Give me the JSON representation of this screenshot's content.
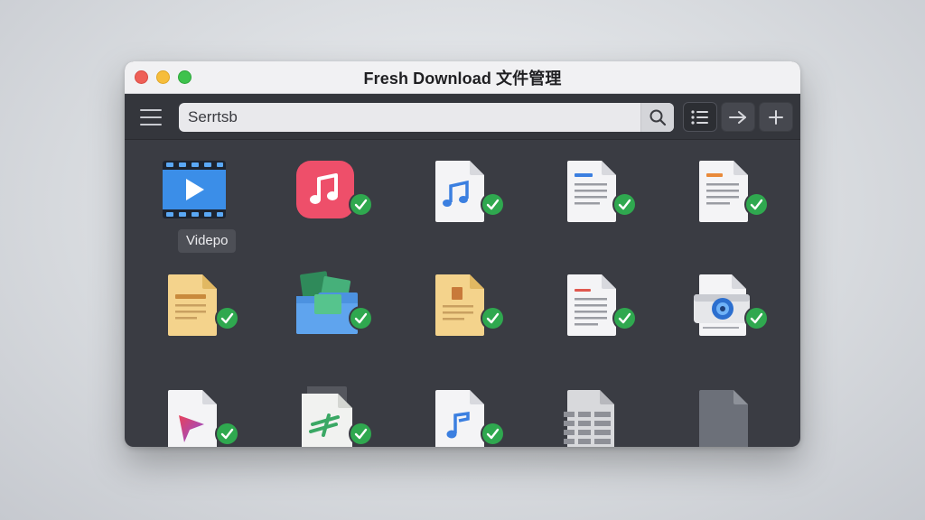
{
  "window": {
    "title": "Fresh Download 文件管理"
  },
  "toolbar": {
    "search_value": "Serrtsb",
    "buttons": [
      {
        "name": "list-view",
        "icon": "list-icon"
      },
      {
        "name": "forward",
        "icon": "arrow-right-icon"
      },
      {
        "name": "add",
        "icon": "plus-icon"
      }
    ]
  },
  "files": [
    {
      "type": "video",
      "label": "Videpo",
      "icon": "video-file-icon",
      "downloaded": false
    },
    {
      "type": "music-app",
      "label": "",
      "icon": "music-app-icon",
      "downloaded": true
    },
    {
      "type": "audio",
      "label": "",
      "icon": "audio-file-icon",
      "downloaded": true
    },
    {
      "type": "document",
      "label": "",
      "icon": "document-blue-icon",
      "downloaded": true
    },
    {
      "type": "document",
      "label": "",
      "icon": "document-orange-icon",
      "downloaded": true
    },
    {
      "type": "document",
      "label": "",
      "icon": "document-yellow-icon",
      "downloaded": true
    },
    {
      "type": "folder",
      "label": "",
      "icon": "image-folder-icon",
      "downloaded": true
    },
    {
      "type": "document",
      "label": "",
      "icon": "document-gold-icon",
      "downloaded": true
    },
    {
      "type": "document",
      "label": "",
      "icon": "document-red-icon",
      "downloaded": true
    },
    {
      "type": "image",
      "label": "",
      "icon": "camera-file-icon",
      "downloaded": true
    },
    {
      "type": "vector",
      "label": "",
      "icon": "vector-file-icon",
      "downloaded": true
    },
    {
      "type": "archive",
      "label": "",
      "icon": "green-file-icon",
      "downloaded": true
    },
    {
      "type": "audio",
      "label": "",
      "icon": "audio-file-icon",
      "downloaded": true
    },
    {
      "type": "spreadsheet",
      "label": "",
      "icon": "spreadsheet-file-icon",
      "downloaded": false
    },
    {
      "type": "generic",
      "label": "",
      "icon": "gray-file-icon",
      "downloaded": false
    }
  ],
  "colors": {
    "accent_green": "#2fa84f",
    "window_bg": "#3a3c43",
    "toolbar_bg": "#34363c"
  }
}
